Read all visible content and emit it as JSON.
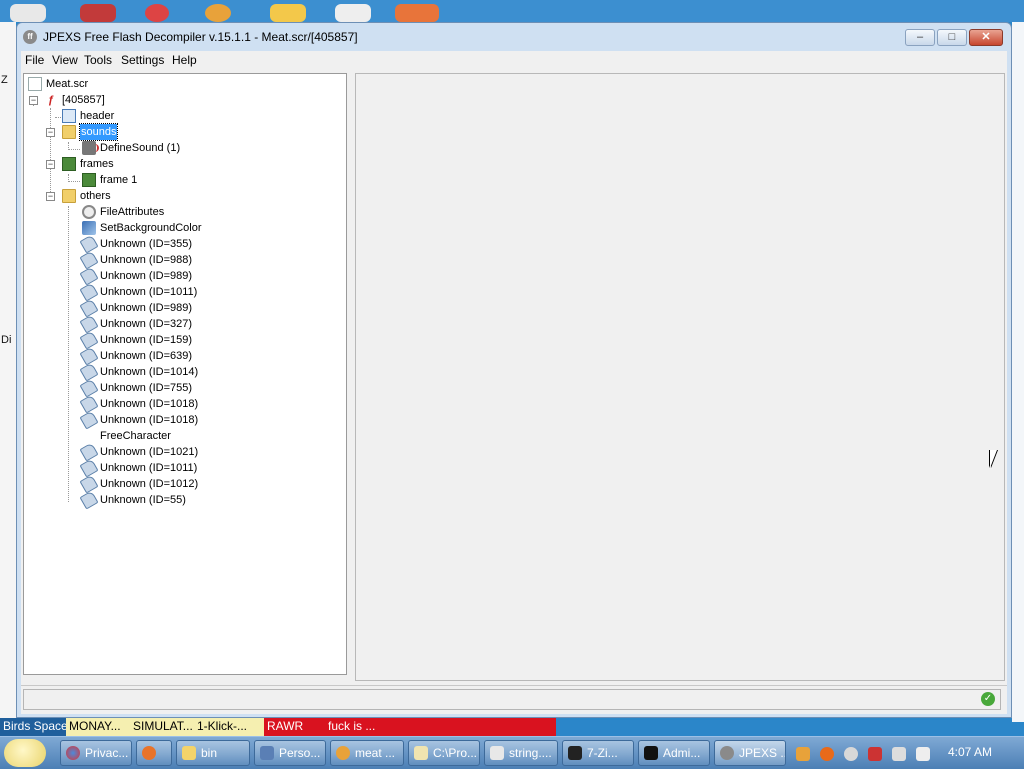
{
  "window": {
    "title": "JPEXS Free Flash Decompiler v.15.1.1 - Meat.scr/[405857]",
    "app_icon": "ff-logo-icon"
  },
  "menu": [
    "File",
    "View",
    "Tools",
    "Settings",
    "Help"
  ],
  "tree": {
    "root": "Meat.scr",
    "swf": "[405857]",
    "header": "header",
    "sounds": "sounds",
    "define_sound": "DefineSound (1)",
    "frames": "frames",
    "frame1": "frame 1",
    "others": "others",
    "file_attributes": "FileAttributes",
    "set_bg": "SetBackgroundColor",
    "tags": [
      "Unknown (ID=355)",
      "Unknown (ID=988)",
      "Unknown (ID=989)",
      "Unknown (ID=1011)",
      "Unknown (ID=989)",
      "Unknown (ID=327)",
      "Unknown (ID=159)",
      "Unknown (ID=639)",
      "Unknown (ID=1014)",
      "Unknown (ID=755)",
      "Unknown (ID=1018)",
      "Unknown (ID=1018)",
      "FreeCharacter",
      "Unknown (ID=1021)",
      "Unknown (ID=1011)",
      "Unknown (ID=1012)",
      "Unknown (ID=55)"
    ]
  },
  "desktop": {
    "left_labels": [
      "Z",
      "Di"
    ]
  },
  "notifications": [
    "Birds Space",
    "MONAY...",
    "SIMULAT...",
    "1-Klick-...",
    "RAWR",
    "fuck is ..."
  ],
  "taskbar": {
    "buttons": [
      "Privac...",
      "",
      "bin",
      "Perso...",
      "meat ...",
      "C:\\Pro...",
      "string....",
      "7-Zi...",
      "Admi...",
      "JPEXS ..."
    ],
    "clock": "4:07 AM"
  },
  "colors": {
    "selection": "#3399ff",
    "titlebar": "#cfe0f2",
    "taskbar": "#4c7fb5",
    "notif_yellow": "#f5efb0",
    "notif_red": "#d9121f"
  }
}
